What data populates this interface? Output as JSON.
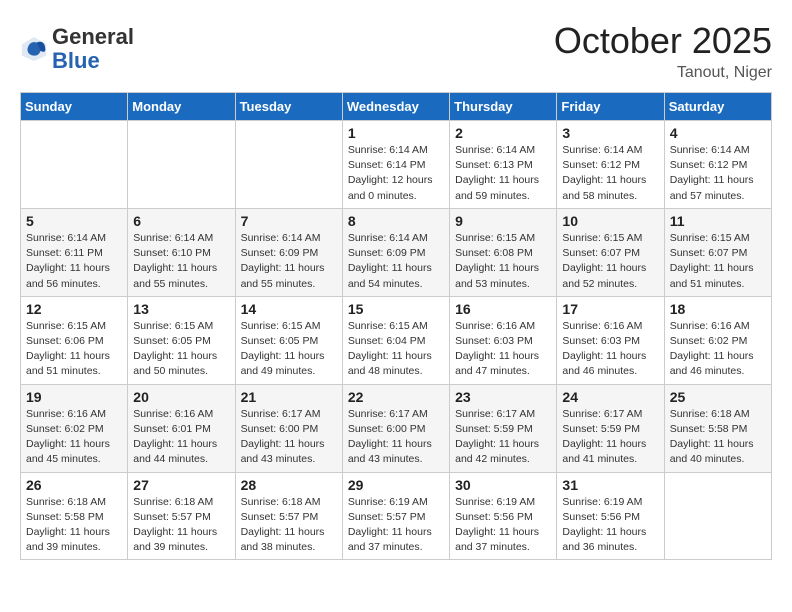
{
  "header": {
    "logo_general": "General",
    "logo_blue": "Blue",
    "month": "October 2025",
    "location": "Tanout, Niger"
  },
  "weekdays": [
    "Sunday",
    "Monday",
    "Tuesday",
    "Wednesday",
    "Thursday",
    "Friday",
    "Saturday"
  ],
  "weeks": [
    [
      {
        "day": "",
        "sunrise": "",
        "sunset": "",
        "daylight": ""
      },
      {
        "day": "",
        "sunrise": "",
        "sunset": "",
        "daylight": ""
      },
      {
        "day": "",
        "sunrise": "",
        "sunset": "",
        "daylight": ""
      },
      {
        "day": "1",
        "sunrise": "Sunrise: 6:14 AM",
        "sunset": "Sunset: 6:14 PM",
        "daylight": "Daylight: 12 hours and 0 minutes."
      },
      {
        "day": "2",
        "sunrise": "Sunrise: 6:14 AM",
        "sunset": "Sunset: 6:13 PM",
        "daylight": "Daylight: 11 hours and 59 minutes."
      },
      {
        "day": "3",
        "sunrise": "Sunrise: 6:14 AM",
        "sunset": "Sunset: 6:12 PM",
        "daylight": "Daylight: 11 hours and 58 minutes."
      },
      {
        "day": "4",
        "sunrise": "Sunrise: 6:14 AM",
        "sunset": "Sunset: 6:12 PM",
        "daylight": "Daylight: 11 hours and 57 minutes."
      }
    ],
    [
      {
        "day": "5",
        "sunrise": "Sunrise: 6:14 AM",
        "sunset": "Sunset: 6:11 PM",
        "daylight": "Daylight: 11 hours and 56 minutes."
      },
      {
        "day": "6",
        "sunrise": "Sunrise: 6:14 AM",
        "sunset": "Sunset: 6:10 PM",
        "daylight": "Daylight: 11 hours and 55 minutes."
      },
      {
        "day": "7",
        "sunrise": "Sunrise: 6:14 AM",
        "sunset": "Sunset: 6:09 PM",
        "daylight": "Daylight: 11 hours and 55 minutes."
      },
      {
        "day": "8",
        "sunrise": "Sunrise: 6:14 AM",
        "sunset": "Sunset: 6:09 PM",
        "daylight": "Daylight: 11 hours and 54 minutes."
      },
      {
        "day": "9",
        "sunrise": "Sunrise: 6:15 AM",
        "sunset": "Sunset: 6:08 PM",
        "daylight": "Daylight: 11 hours and 53 minutes."
      },
      {
        "day": "10",
        "sunrise": "Sunrise: 6:15 AM",
        "sunset": "Sunset: 6:07 PM",
        "daylight": "Daylight: 11 hours and 52 minutes."
      },
      {
        "day": "11",
        "sunrise": "Sunrise: 6:15 AM",
        "sunset": "Sunset: 6:07 PM",
        "daylight": "Daylight: 11 hours and 51 minutes."
      }
    ],
    [
      {
        "day": "12",
        "sunrise": "Sunrise: 6:15 AM",
        "sunset": "Sunset: 6:06 PM",
        "daylight": "Daylight: 11 hours and 51 minutes."
      },
      {
        "day": "13",
        "sunrise": "Sunrise: 6:15 AM",
        "sunset": "Sunset: 6:05 PM",
        "daylight": "Daylight: 11 hours and 50 minutes."
      },
      {
        "day": "14",
        "sunrise": "Sunrise: 6:15 AM",
        "sunset": "Sunset: 6:05 PM",
        "daylight": "Daylight: 11 hours and 49 minutes."
      },
      {
        "day": "15",
        "sunrise": "Sunrise: 6:15 AM",
        "sunset": "Sunset: 6:04 PM",
        "daylight": "Daylight: 11 hours and 48 minutes."
      },
      {
        "day": "16",
        "sunrise": "Sunrise: 6:16 AM",
        "sunset": "Sunset: 6:03 PM",
        "daylight": "Daylight: 11 hours and 47 minutes."
      },
      {
        "day": "17",
        "sunrise": "Sunrise: 6:16 AM",
        "sunset": "Sunset: 6:03 PM",
        "daylight": "Daylight: 11 hours and 46 minutes."
      },
      {
        "day": "18",
        "sunrise": "Sunrise: 6:16 AM",
        "sunset": "Sunset: 6:02 PM",
        "daylight": "Daylight: 11 hours and 46 minutes."
      }
    ],
    [
      {
        "day": "19",
        "sunrise": "Sunrise: 6:16 AM",
        "sunset": "Sunset: 6:02 PM",
        "daylight": "Daylight: 11 hours and 45 minutes."
      },
      {
        "day": "20",
        "sunrise": "Sunrise: 6:16 AM",
        "sunset": "Sunset: 6:01 PM",
        "daylight": "Daylight: 11 hours and 44 minutes."
      },
      {
        "day": "21",
        "sunrise": "Sunrise: 6:17 AM",
        "sunset": "Sunset: 6:00 PM",
        "daylight": "Daylight: 11 hours and 43 minutes."
      },
      {
        "day": "22",
        "sunrise": "Sunrise: 6:17 AM",
        "sunset": "Sunset: 6:00 PM",
        "daylight": "Daylight: 11 hours and 43 minutes."
      },
      {
        "day": "23",
        "sunrise": "Sunrise: 6:17 AM",
        "sunset": "Sunset: 5:59 PM",
        "daylight": "Daylight: 11 hours and 42 minutes."
      },
      {
        "day": "24",
        "sunrise": "Sunrise: 6:17 AM",
        "sunset": "Sunset: 5:59 PM",
        "daylight": "Daylight: 11 hours and 41 minutes."
      },
      {
        "day": "25",
        "sunrise": "Sunrise: 6:18 AM",
        "sunset": "Sunset: 5:58 PM",
        "daylight": "Daylight: 11 hours and 40 minutes."
      }
    ],
    [
      {
        "day": "26",
        "sunrise": "Sunrise: 6:18 AM",
        "sunset": "Sunset: 5:58 PM",
        "daylight": "Daylight: 11 hours and 39 minutes."
      },
      {
        "day": "27",
        "sunrise": "Sunrise: 6:18 AM",
        "sunset": "Sunset: 5:57 PM",
        "daylight": "Daylight: 11 hours and 39 minutes."
      },
      {
        "day": "28",
        "sunrise": "Sunrise: 6:18 AM",
        "sunset": "Sunset: 5:57 PM",
        "daylight": "Daylight: 11 hours and 38 minutes."
      },
      {
        "day": "29",
        "sunrise": "Sunrise: 6:19 AM",
        "sunset": "Sunset: 5:57 PM",
        "daylight": "Daylight: 11 hours and 37 minutes."
      },
      {
        "day": "30",
        "sunrise": "Sunrise: 6:19 AM",
        "sunset": "Sunset: 5:56 PM",
        "daylight": "Daylight: 11 hours and 37 minutes."
      },
      {
        "day": "31",
        "sunrise": "Sunrise: 6:19 AM",
        "sunset": "Sunset: 5:56 PM",
        "daylight": "Daylight: 11 hours and 36 minutes."
      },
      {
        "day": "",
        "sunrise": "",
        "sunset": "",
        "daylight": ""
      }
    ]
  ]
}
